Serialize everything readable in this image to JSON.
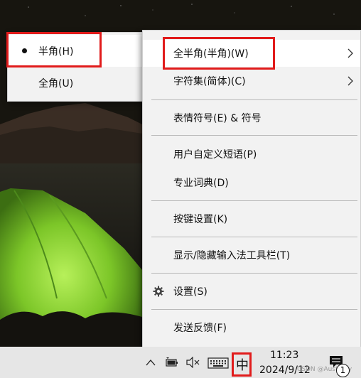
{
  "submenu": {
    "items": [
      {
        "label": "半角(H)",
        "selected": true
      },
      {
        "label": "全角(U)",
        "selected": false
      }
    ]
  },
  "menu": {
    "items": [
      {
        "label": "全半角(半角)(W)",
        "submenu": true
      },
      {
        "label": "字符集(简体)(C)",
        "submenu": true
      },
      {
        "label": "表情符号(E) & 符号"
      },
      {
        "label": "用户自定义短语(P)"
      },
      {
        "label": "专业词典(D)"
      },
      {
        "label": "按键设置(K)"
      },
      {
        "label": "显示/隐藏输入法工具栏(T)"
      },
      {
        "label": "设置(S)",
        "icon": "gear-icon"
      },
      {
        "label": "发送反馈(F)"
      }
    ]
  },
  "taskbar": {
    "ime_mode": "中",
    "time": "11:23",
    "date": "2024/9/12",
    "notification_count": "1",
    "watermark": "CSDN @Aust...gy",
    "icons": [
      "chevron-up-icon",
      "battery-icon",
      "volume-muted-icon",
      "keyboard-icon",
      "ime-icon",
      "notification-icon"
    ]
  },
  "colors": {
    "highlight_box": "#e11b1b",
    "menu_bg": "#f2f2f2",
    "menu_hover": "#ffffff",
    "taskbar_bg": "#e6e6e6"
  }
}
